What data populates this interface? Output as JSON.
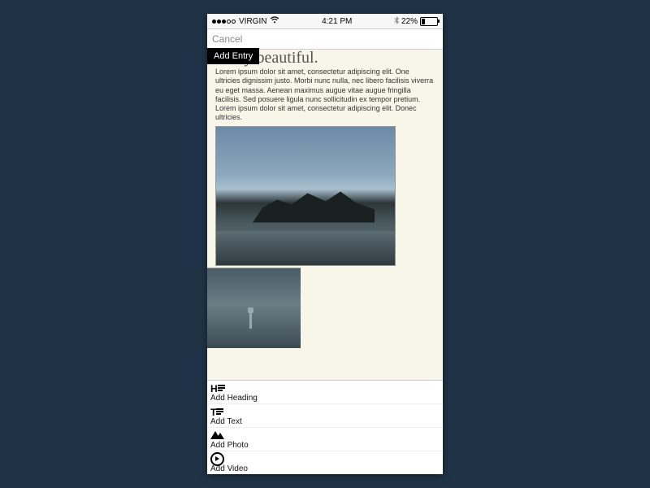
{
  "statusbar": {
    "carrier": "VIRGIN",
    "time": "4:21 PM",
    "battery": "22%"
  },
  "nav": {
    "cancel": "Cancel"
  },
  "tooltip": "Add Entry",
  "entry": {
    "heading_visible": "really beautiful.",
    "body": "Lorem ipsum dolor sit amet, consectetur adipiscing elit. One ultricies dignissim justo. Morbi nunc nulla, nec libero facilisis viverra eu eget massa. Aenean maximus augue vitae augue fringilla facilisis. Sed posuere ligula nunc sollicitudin ex tempor pretium. Lorem ipsum dolor sit amet, consectetur adipiscing elit. Donec ultricies."
  },
  "toolbar": {
    "heading": "Add Heading",
    "text": "Add Text",
    "photo": "Add Photo",
    "video": "Add Video"
  }
}
